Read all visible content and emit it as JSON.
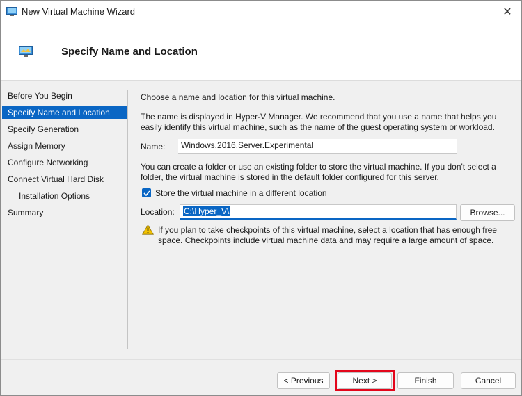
{
  "window": {
    "title": "New Virtual Machine Wizard",
    "close_glyph": "✕"
  },
  "header": {
    "title": "Specify Name and Location"
  },
  "nav": {
    "items": [
      {
        "label": "Before You Begin",
        "active": false
      },
      {
        "label": "Specify Name and Location",
        "active": true
      },
      {
        "label": "Specify Generation",
        "active": false
      },
      {
        "label": "Assign Memory",
        "active": false
      },
      {
        "label": "Configure Networking",
        "active": false
      },
      {
        "label": "Connect Virtual Hard Disk",
        "active": false
      },
      {
        "label": "Installation Options",
        "active": false
      },
      {
        "label": "Summary",
        "active": false
      }
    ]
  },
  "content": {
    "intro": "Choose a name and location for this virtual machine.",
    "name_desc": "The name is displayed in Hyper-V Manager. We recommend that you use a name that helps you easily identify this virtual machine, such as the name of the guest operating system or workload.",
    "name_label": "Name:",
    "name_value": "Windows.2016.Server.Experimental",
    "folder_desc": "You can create a folder or use an existing folder to store the virtual machine. If you don't select a folder, the virtual machine is stored in the default folder configured for this server.",
    "store_checkbox_label": "Store the virtual machine in a different location",
    "store_checked": true,
    "location_label": "Location:",
    "location_value": "C:\\Hyper_V\\",
    "browse_label": "Browse...",
    "warning_text": "If you plan to take checkpoints of this virtual machine, select a location that has enough free space. Checkpoints include virtual machine data and may require a large amount of space."
  },
  "footer": {
    "previous_label": "< Previous",
    "next_label": "Next >",
    "finish_label": "Finish",
    "cancel_label": "Cancel"
  },
  "colors": {
    "accent": "#0a66c4",
    "highlight": "#e3061b",
    "warning": "#f2c200"
  }
}
